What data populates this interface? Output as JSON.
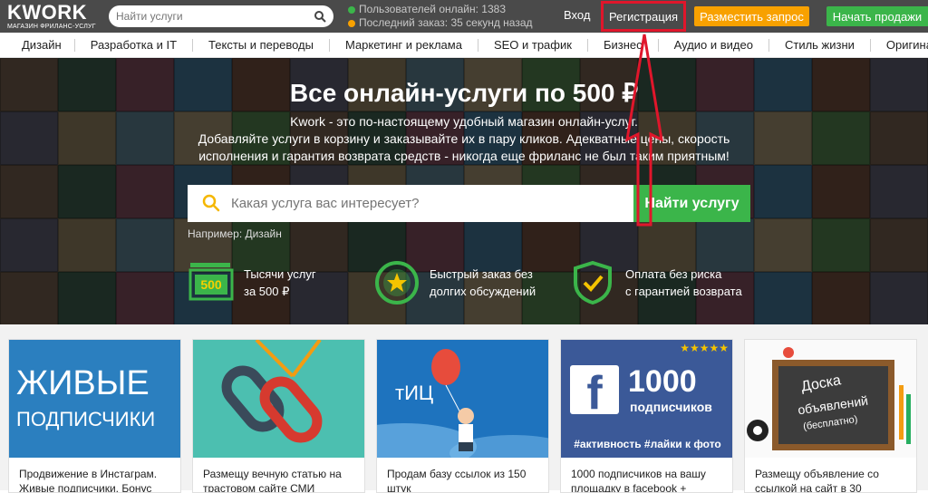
{
  "header": {
    "logo_text": "KWORK",
    "logo_sub": "МАГАЗИН ФРИЛАНС-УСЛУГ",
    "search_placeholder": "Найти услуги",
    "online_users": "Пользователей онлайн: 1383",
    "last_order": "Последний заказ: 35 секунд назад",
    "login": "Вход",
    "register": "Регистрация",
    "post_request": "Разместить запрос",
    "start_selling": "Начать продажи"
  },
  "categories": [
    "Дизайн",
    "Разработка и IT",
    "Тексты и переводы",
    "Маркетинг и реклама",
    "SEO и трафик",
    "Бизнес",
    "Аудио и видео",
    "Стиль жизни",
    "Оригинальное"
  ],
  "hero": {
    "title": "Все онлайн-услуги по 500 ₽",
    "subtitle_1": "Kwork - это по-настоящему удобный магазин онлайн-услуг.",
    "subtitle_2": "Добавляйте услуги в корзину и заказывайте их в пару кликов. Адекватные цены, скорость",
    "subtitle_3": "исполнения и гарантия возврата средств - никогда еще фриланс не был таким приятным!",
    "search_placeholder": "Какая услуга вас интересует?",
    "search_button": "Найти услугу",
    "example": "Например: Дизайн",
    "features": [
      {
        "icon_text": "500",
        "line1": "Тысячи услуг",
        "line2": "за 500 ₽"
      },
      {
        "line1": "Быстрый заказ без",
        "line2": "долгих обсуждений"
      },
      {
        "line1": "Оплата без риска",
        "line2": "с гарантией возврата"
      }
    ]
  },
  "cards": [
    {
      "img_text_1": "ЖИВЫЕ",
      "img_text_2": "ПОДПИСЧИКИ",
      "caption_1": "Продвижение в Инстаграм.",
      "caption_2": "Живые подписчики. Бонус"
    },
    {
      "caption_1": "Размещу вечную статью на",
      "caption_2": "трастовом сайте СМИ"
    },
    {
      "img_text_1": "тИЦ",
      "caption_1": "Продам базу ссылок из 150",
      "caption_2": "штук"
    },
    {
      "img_text_1": "1000",
      "img_text_2": "подписчиков",
      "img_text_3": "#активность #лайки к фото",
      "caption_1": "1000 подписчиков на вашу",
      "caption_2": "площадку в facebook +"
    },
    {
      "img_text_1": "Доска",
      "img_text_2": "объявлений",
      "img_text_3": "(бесплатно)",
      "caption_1": "Размещу объявление со",
      "caption_2": "ссылкой на сайт в 30"
    }
  ],
  "colors": {
    "green": "#3bb54a",
    "orange": "#f8a100",
    "highlight_red": "#e0162b",
    "topbar": "#4a4a4a"
  }
}
